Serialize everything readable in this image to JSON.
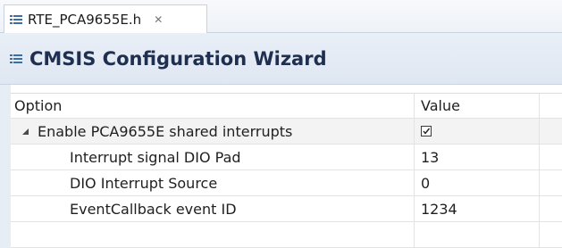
{
  "tab": {
    "title": "RTE_PCA9655E.h",
    "close_glyph": "✕"
  },
  "wizard": {
    "title": "CMSIS Configuration Wizard"
  },
  "table": {
    "headers": {
      "option": "Option",
      "value": "Value"
    },
    "rows": [
      {
        "label": "Enable PCA9655E shared interrupts",
        "value": "",
        "checked": true
      },
      {
        "label": "Interrupt signal DIO Pad",
        "value": "13"
      },
      {
        "label": "DIO Interrupt Source",
        "value": "0"
      },
      {
        "label": "EventCallback event ID",
        "value": "1234"
      }
    ]
  },
  "colors": {
    "accent": "#1f2f4f",
    "icon_blue": "#3a6ea5"
  },
  "icons": {
    "tab": "list-icon",
    "title": "list-icon",
    "expander": "triangle-expanded-icon",
    "check": "checkbox-checked-icon"
  }
}
